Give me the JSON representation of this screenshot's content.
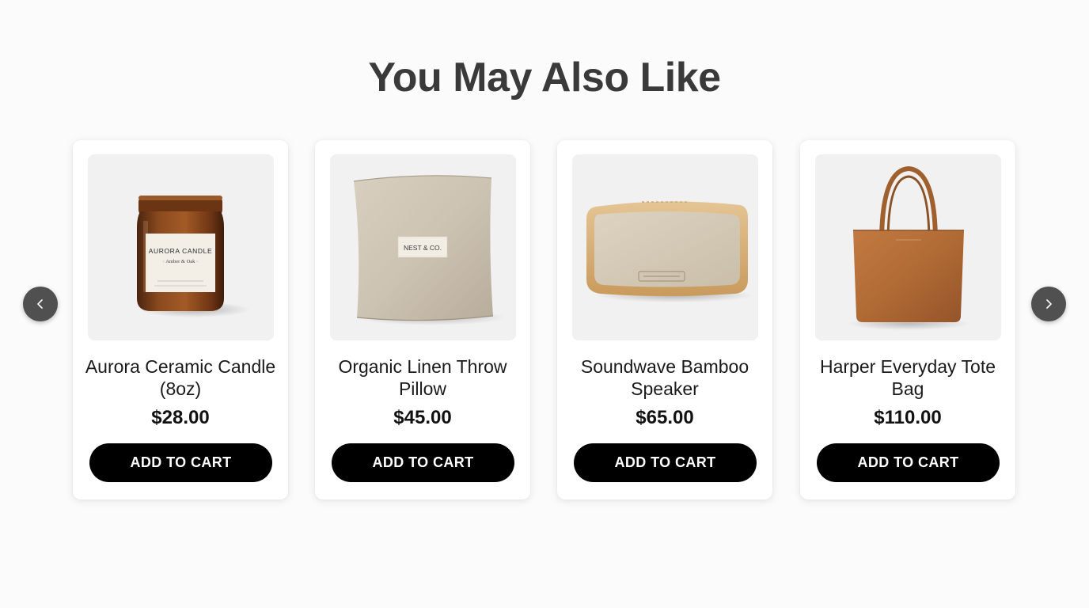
{
  "section": {
    "title": "You May Also Like"
  },
  "carousel": {
    "prev_icon": "chevron-left-icon",
    "next_icon": "chevron-right-icon"
  },
  "products": [
    {
      "name": "Aurora Ceramic Candle (8oz)",
      "price": "$28.00",
      "button_label": "ADD TO CART",
      "image": "amber-candle-jar",
      "image_label_line1": "AURORA CANDLE",
      "image_label_line2": "· Amber & Oak ·"
    },
    {
      "name": "Organic Linen Throw Pillow",
      "price": "$45.00",
      "button_label": "ADD TO CART",
      "image": "linen-pillow",
      "image_label_line1": "NEST & CO."
    },
    {
      "name": "Soundwave Bamboo Speaker",
      "price": "$65.00",
      "button_label": "ADD TO CART",
      "image": "bamboo-speaker"
    },
    {
      "name": "Harper Everyday Tote Bag",
      "price": "$110.00",
      "button_label": "ADD TO CART",
      "image": "leather-tote-bag"
    }
  ],
  "colors": {
    "background": "#fbfbfb",
    "title": "#3a3a3a",
    "button_bg": "#000000",
    "button_text": "#ffffff",
    "arrow_bg": "#505050",
    "image_bg": "#f1f1f1"
  }
}
